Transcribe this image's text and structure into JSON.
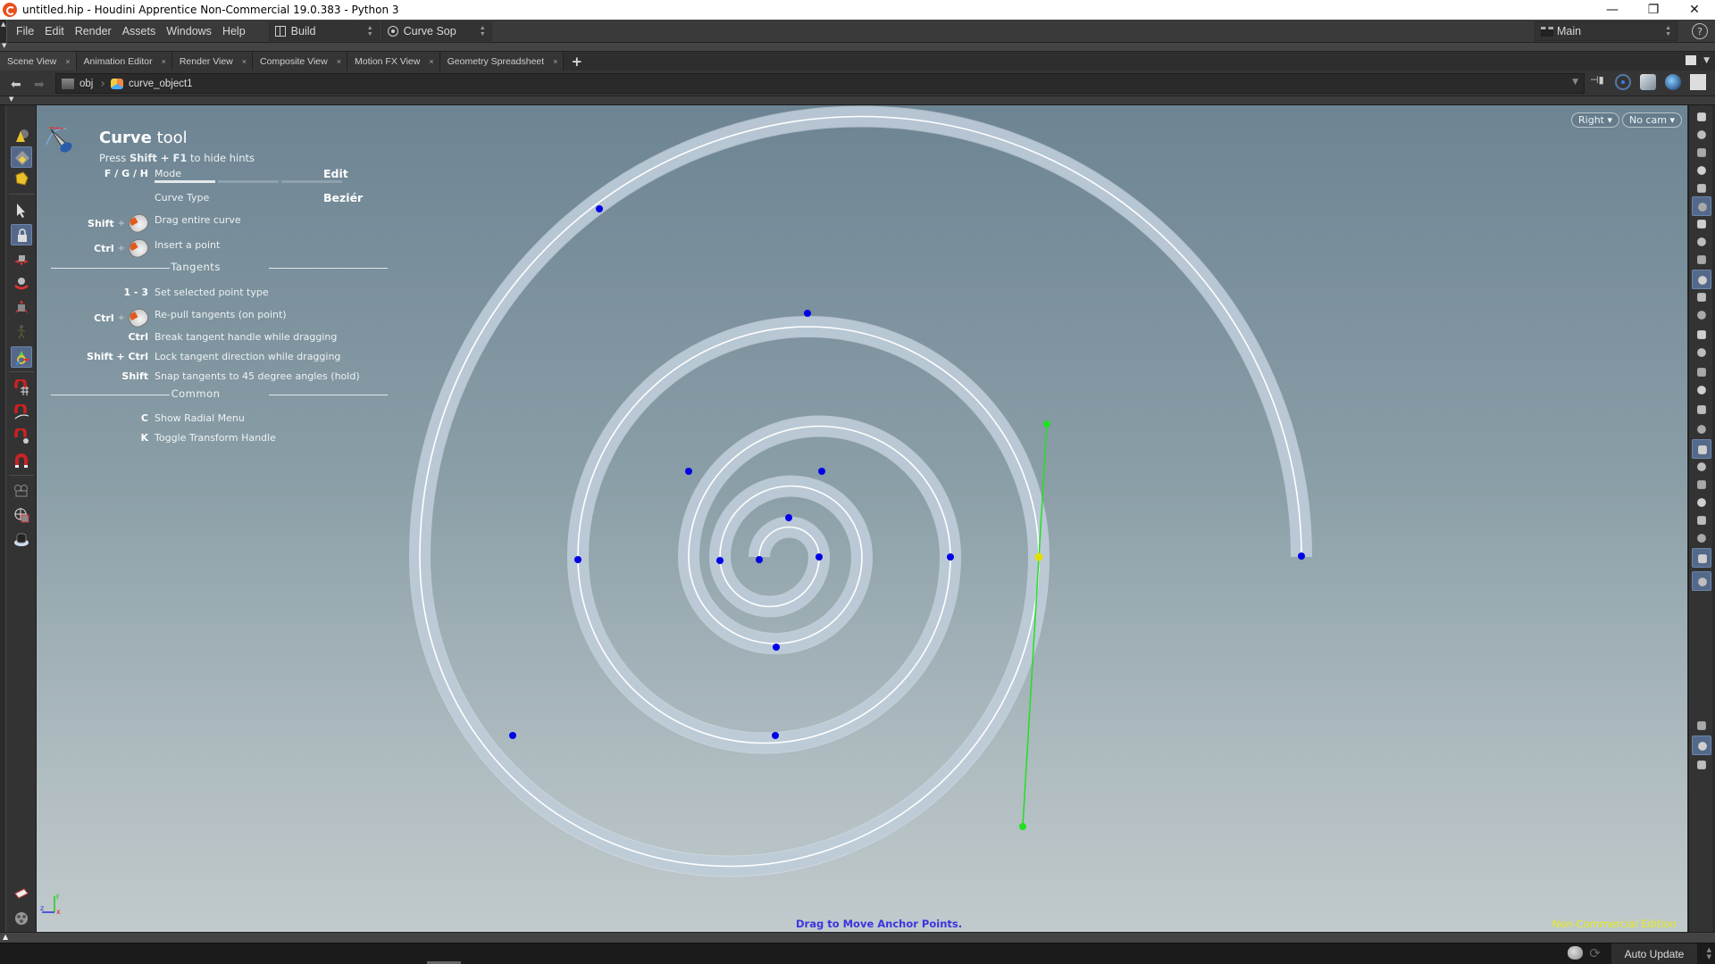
{
  "window": {
    "title": "untitled.hip - Houdini Apprentice Non-Commercial 19.0.383 - Python 3",
    "controls": {
      "minimize": "—",
      "restore": "❐",
      "close": "✕"
    }
  },
  "menubar": {
    "items": [
      "File",
      "Edit",
      "Render",
      "Assets",
      "Windows",
      "Help"
    ],
    "desktop": "Build",
    "context": "Curve Sop",
    "workspace": "Main",
    "help": "?"
  },
  "tabs": [
    {
      "label": "Scene View",
      "active": true
    },
    {
      "label": "Animation Editor",
      "active": false
    },
    {
      "label": "Render View",
      "active": false
    },
    {
      "label": "Composite View",
      "active": false
    },
    {
      "label": "Motion FX View",
      "active": false
    },
    {
      "label": "Geometry Spreadsheet",
      "active": false
    }
  ],
  "tab_close": "×",
  "tab_add": "+",
  "path": {
    "crumbs": [
      "obj",
      "curve_object1"
    ]
  },
  "viewport": {
    "camera_view": "Right ▾",
    "camera": "No cam ▾",
    "status_message": "Drag to Move Anchor Points.",
    "edition": "Non-Commercial Edition",
    "axes": {
      "y": "y",
      "z": "z",
      "x": "x"
    }
  },
  "hints": {
    "tool_name": "Curve",
    "tool_suffix": "tool",
    "hide_prefix": "Press",
    "hide_keys": "Shift + F1",
    "hide_suffix": "to hide hints",
    "mode": {
      "keys": "F / G / H",
      "label": "Mode",
      "value": "Edit",
      "active_segment": 1,
      "segments": 3
    },
    "curve_type": {
      "label": "Curve Type",
      "value": "Beziér"
    },
    "rows_top": [
      {
        "key": "Shift",
        "mouse": true,
        "desc": "Drag entire curve"
      },
      {
        "key": "Ctrl",
        "mouse": true,
        "desc": "Insert a point"
      }
    ],
    "tangents_header": "Tangents",
    "tangent_rows": [
      {
        "key": "1 - 3",
        "mouse": false,
        "desc": "Set selected point type"
      },
      {
        "key": "Ctrl",
        "mouse": true,
        "desc": "Re-pull tangents (on point)"
      },
      {
        "key": "Ctrl",
        "mouse": false,
        "desc": "Break tangent handle while dragging"
      },
      {
        "key": "Shift + Ctrl",
        "mouse": false,
        "desc": "Lock tangent direction while dragging"
      },
      {
        "key": "Shift",
        "mouse": false,
        "desc": "Snap tangents to 45 degree angles (hold)"
      }
    ],
    "common_header": "Common",
    "common_rows": [
      {
        "key": "C",
        "desc": "Show Radial Menu"
      },
      {
        "key": "K",
        "desc": "Toggle Transform Handle"
      }
    ]
  },
  "statusbar": {
    "auto_update": "Auto Update"
  },
  "left_toolbar": [
    "create-geometry-icon",
    "select-mode-icon",
    "object-mode-icon",
    "select-arrow-icon",
    "lock-select-icon",
    "move-icon",
    "rotate-icon",
    "scale-icon",
    "pose-icon",
    "handle-icon",
    "snap-grid-icon",
    "snap-curve-icon",
    "snap-point-icon",
    "snap-magnet-icon",
    "camera-icon",
    "view-camera-icon",
    "flipbook-icon",
    "render-icon",
    "record-icon"
  ],
  "right_toolbar": [
    "display-options-icon",
    "ghost-icon",
    "lock-camera-icon",
    "light-off-icon",
    "headlight-icon",
    "normal-light-icon",
    "high-quality-light-icon",
    "shadow-light-icon",
    "wireframe-cube-icon",
    "shade-mode-icon",
    "background-icon",
    "point-display-icon",
    "point-normal-icon",
    "point-vector-icon",
    "point-number-icon",
    "prim-normal-icon",
    "prim-number-icon",
    "vertex-icon",
    "face-icon",
    "uv-icon",
    "bounding-box-icon",
    "nodes-icon",
    "particles-icon",
    "grouped-icon",
    "background-image-icon",
    "pin-icon",
    "info-icon",
    "layout-grid-icon",
    "visibility-icon"
  ],
  "colors": {
    "viewport_top": "#6d8493",
    "viewport_bottom": "#c1cacc",
    "curve_point": "#0000e8",
    "selected_point": "#e0e000",
    "tangent_handle": "#22e022",
    "status_message": "#3a34e0",
    "edition": "#e6ea1d"
  }
}
